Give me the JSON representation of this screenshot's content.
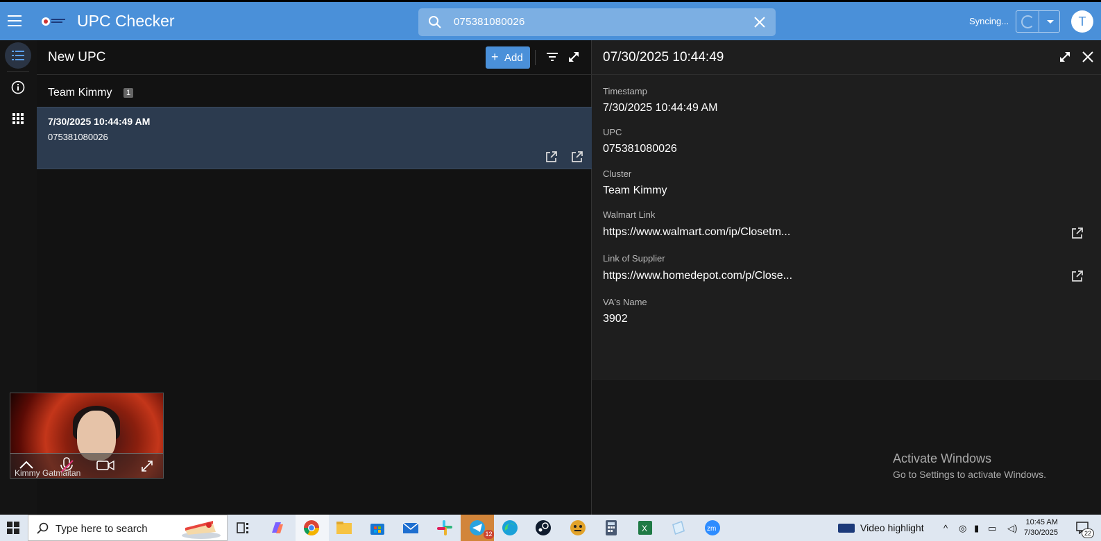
{
  "app": {
    "title": "UPC Checker",
    "accent": "#4a90d9"
  },
  "search": {
    "value": "075381080026",
    "icon": "search-icon",
    "clear_icon": "close-icon"
  },
  "sync": {
    "label": "Syncing..."
  },
  "user": {
    "avatar_letter": "T"
  },
  "nav": {
    "items": [
      {
        "name": "list-icon",
        "active": true
      },
      {
        "name": "info-icon",
        "active": false
      },
      {
        "name": "apps-grid-icon",
        "active": false
      }
    ]
  },
  "list_pane": {
    "title": "New UPC",
    "add_label": "Add",
    "group": {
      "name": "Team Kimmy",
      "count": "1"
    },
    "rows": [
      {
        "timestamp": "7/30/2025 10:44:49 AM",
        "upc": "075381080026"
      }
    ]
  },
  "detail": {
    "title": "07/30/2025 10:44:49",
    "fields": [
      {
        "label": "Timestamp",
        "value": "7/30/2025 10:44:49 AM"
      },
      {
        "label": "UPC",
        "value": "075381080026"
      },
      {
        "label": "Cluster",
        "value": "Team Kimmy"
      },
      {
        "label": "Walmart Link",
        "value": "https://www.walmart.com/ip/Closetm..."
      },
      {
        "label": "Link of Supplier",
        "value": "https://www.homedepot.com/p/Close..."
      },
      {
        "label": "VA's Name",
        "value": "3902"
      }
    ]
  },
  "watermark": {
    "line1": "Activate Windows",
    "line2": "Go to Settings to activate Windows."
  },
  "video": {
    "participant_name": "Kimmy Gatmaitan"
  },
  "taskbar": {
    "search_placeholder": "Type here to search",
    "telegram_badge": "12",
    "video_highlight": "Video highlight",
    "time": "10:45 AM",
    "date": "7/30/2025",
    "notification_count": "22"
  }
}
